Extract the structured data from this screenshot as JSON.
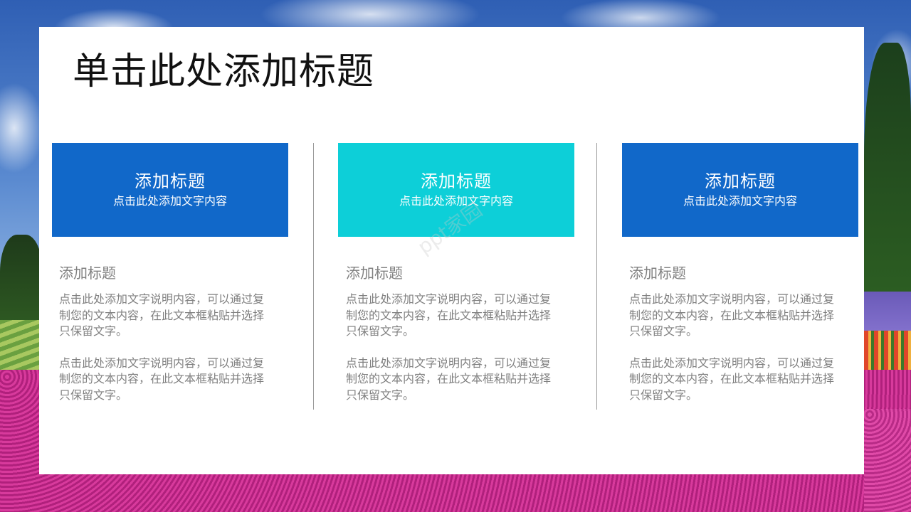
{
  "slide": {
    "title": "单击此处添加标题"
  },
  "colors": {
    "card_blue": "#1168c9",
    "card_teal": "#0dcfd8",
    "text_gray": "#808080",
    "divider": "#9a9a9a"
  },
  "cards": [
    {
      "title": "添加标题",
      "subtitle": "点击此处添加文字内容",
      "color": "#1168c9"
    },
    {
      "title": "添加标题",
      "subtitle": "点击此处添加文字内容",
      "color": "#0dcfd8"
    },
    {
      "title": "添加标题",
      "subtitle": "点击此处添加文字内容",
      "color": "#1168c9"
    }
  ],
  "columns": [
    {
      "heading": "添加标题",
      "paragraphs": [
        "点击此处添加文字说明内容，可以通过复制您的文本内容，在此文本框粘贴并选择只保留文字。",
        "点击此处添加文字说明内容，可以通过复制您的文本内容，在此文本框粘贴并选择只保留文字。"
      ]
    },
    {
      "heading": "添加标题",
      "paragraphs": [
        "点击此处添加文字说明内容，可以通过复制您的文本内容，在此文本框粘贴并选择只保留文字。",
        "点击此处添加文字说明内容，可以通过复制您的文本内容，在此文本框粘贴并选择只保留文字。"
      ]
    },
    {
      "heading": "添加标题",
      "paragraphs": [
        "点击此处添加文字说明内容，可以通过复制您的文本内容，在此文本框粘贴并选择只保留文字。",
        "点击此处添加文字说明内容，可以通过复制您的文本内容，在此文本框粘贴并选择只保留文字。"
      ]
    }
  ],
  "watermark": "ppt家园"
}
